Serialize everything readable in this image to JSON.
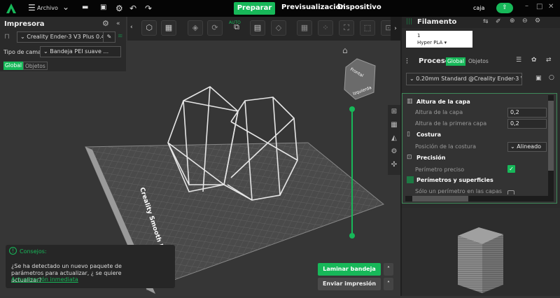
{
  "topbar": {
    "menu_label": "Archivo",
    "tabs": [
      "Preparar",
      "Previsualización",
      "Dispositivo"
    ],
    "project_name": "caja"
  },
  "printer_panel": {
    "title": "Impresora",
    "printer": "Creality Ender-3 V3 Plus 0.4.",
    "bed_label": "Tipo de cama",
    "bed_value": "Bandeja PEI suave ...",
    "tabs": [
      "Global",
      "Objetos"
    ]
  },
  "toolbar": {
    "auto_label": "AUTO"
  },
  "viewcube": {
    "face_top": "Frontal",
    "face_side": "Izquierda"
  },
  "plate": {
    "label": "Creality Smooth PEI Plate"
  },
  "filament": {
    "title": "Filamento",
    "slot_number": "1",
    "material": "Hyper PLA"
  },
  "process": {
    "title": "Proceso",
    "tabs": [
      "Global",
      "Objetos"
    ],
    "preset": "0.20mm Standard @Creality Ender-3 V3 ..."
  },
  "settings": {
    "sections": [
      {
        "title": "Altura de la capa",
        "rows": [
          {
            "label": "Altura de la capa",
            "value": "0,2"
          },
          {
            "label": "Altura de la primera capa",
            "value": "0,2"
          }
        ]
      },
      {
        "title": "Costura",
        "rows": [
          {
            "label": "Posición de la costura",
            "value": "Alineado"
          }
        ]
      },
      {
        "title": "Precisión",
        "rows": [
          {
            "label": "Perímetro preciso",
            "checked": true
          }
        ]
      },
      {
        "title": "Perímetros y superficies",
        "rows": [
          {
            "label": "Sólo un perímetro en las capas",
            "checked": false
          }
        ]
      }
    ]
  },
  "tips": {
    "title": "Consejos:",
    "message": "¿Se ha detectado un nuevo paquete de parámetros para actualizar, ¿ se quiere actualizar?",
    "link": "Actualización inmediata"
  },
  "actions": {
    "slice": "Laminar bandeja",
    "send": "Enviar impresión"
  },
  "colors": {
    "accent": "#17b859",
    "background": "#363636"
  }
}
